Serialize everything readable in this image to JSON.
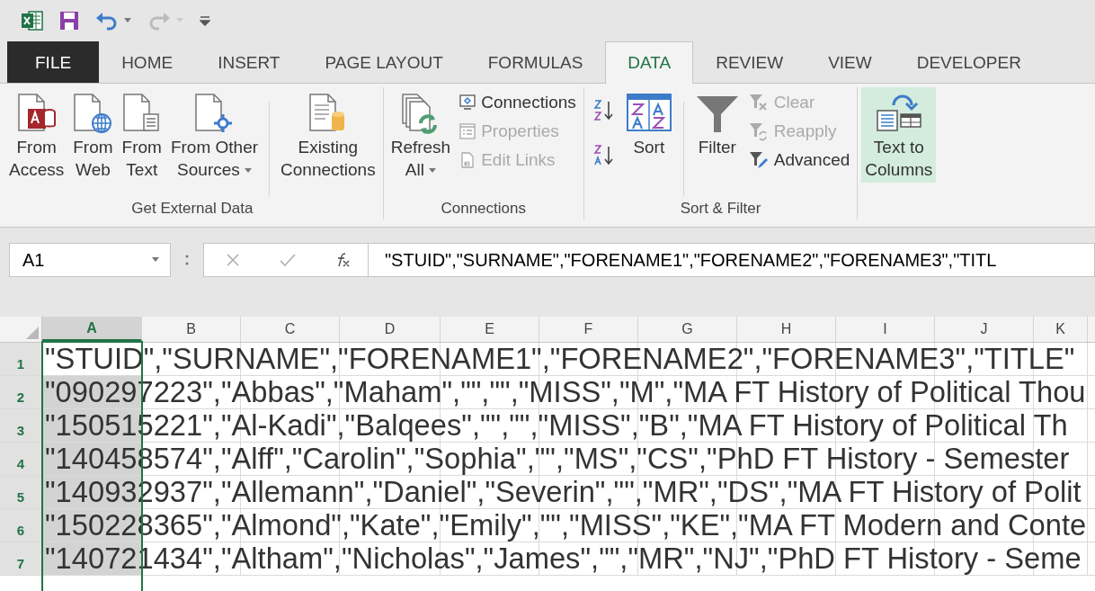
{
  "quick_access": [
    {
      "kind": "app",
      "disabled": false
    },
    {
      "kind": "save",
      "disabled": false
    },
    {
      "kind": "undo",
      "disabled": false
    },
    {
      "kind": "redo",
      "disabled": true
    },
    {
      "kind": "customize",
      "disabled": false
    }
  ],
  "tabs": [
    {
      "label": "FILE",
      "selected": false,
      "kind": "file"
    },
    {
      "label": "HOME",
      "selected": false,
      "kind": "tab"
    },
    {
      "label": "INSERT",
      "selected": false,
      "kind": "tab"
    },
    {
      "label": "PAGE LAYOUT",
      "selected": false,
      "kind": "tab"
    },
    {
      "label": "FORMULAS",
      "selected": false,
      "kind": "tab"
    },
    {
      "label": "DATA",
      "selected": true,
      "kind": "tab"
    },
    {
      "label": "REVIEW",
      "selected": false,
      "kind": "tab"
    },
    {
      "label": "VIEW",
      "selected": false,
      "kind": "tab"
    },
    {
      "label": "DEVELOPER",
      "selected": false,
      "kind": "tab"
    }
  ],
  "ribbon": {
    "groups": [
      {
        "label": "Get External Data",
        "items": [
          {
            "kind": "large",
            "label": "From\nAccess",
            "has_menu": false,
            "highlighted": false
          },
          {
            "kind": "large",
            "label": "From\nWeb",
            "has_menu": false,
            "highlighted": false
          },
          {
            "kind": "large",
            "label": "From\nText",
            "has_menu": false,
            "highlighted": false
          },
          {
            "kind": "large",
            "label": "From Other\nSources",
            "has_menu": true,
            "highlighted": false
          },
          {
            "kind": "separator"
          },
          {
            "kind": "large",
            "label": "Existing\nConnections",
            "has_menu": false,
            "highlighted": false
          }
        ]
      },
      {
        "label": "Connections",
        "items": [
          {
            "kind": "large",
            "label": "Refresh\nAll",
            "has_menu": true,
            "highlighted": false
          },
          {
            "kind": "stack",
            "buttons": [
              {
                "label": "Connections",
                "disabled": false
              },
              {
                "label": "Properties",
                "disabled": true
              },
              {
                "label": "Edit Links",
                "disabled": true
              }
            ]
          }
        ]
      },
      {
        "label": "Sort & Filter",
        "items": [
          {
            "kind": "iconstack"
          },
          {
            "kind": "large",
            "label": "Sort",
            "has_menu": false,
            "highlighted": false
          },
          {
            "kind": "separator"
          },
          {
            "kind": "large",
            "label": "Filter",
            "has_menu": false,
            "highlighted": false
          },
          {
            "kind": "stack",
            "buttons": [
              {
                "label": "Clear",
                "disabled": true
              },
              {
                "label": "Reapply",
                "disabled": true
              },
              {
                "label": "Advanced",
                "disabled": false
              }
            ]
          }
        ]
      },
      {
        "items": [
          {
            "kind": "large",
            "label": "Text to\nColumns",
            "has_menu": false,
            "highlighted": true
          }
        ]
      }
    ]
  },
  "formula_bar": {
    "name_box": "A1",
    "formula": "\"STUID\",\"SURNAME\",\"FORENAME1\",\"FORENAME2\",\"FORENAME3\",\"TITL"
  },
  "grid": {
    "columns": [
      {
        "label": "A",
        "selected": true
      },
      {
        "label": "B",
        "selected": false
      },
      {
        "label": "C",
        "selected": false
      },
      {
        "label": "D",
        "selected": false
      },
      {
        "label": "E",
        "selected": false
      },
      {
        "label": "F",
        "selected": false
      },
      {
        "label": "G",
        "selected": false
      },
      {
        "label": "H",
        "selected": false
      },
      {
        "label": "I",
        "selected": false
      },
      {
        "label": "J",
        "selected": false
      },
      {
        "label": "K",
        "selected": false
      }
    ],
    "rows": [
      {
        "number": "1",
        "active": true,
        "text": "\"STUID\",\"SURNAME\",\"FORENAME1\",\"FORENAME2\",\"FORENAME3\",\"TITLE\""
      },
      {
        "number": "2",
        "active": false,
        "text": "\"090297223\",\"Abbas\",\"Maham\",\"\",\"\",\"MISS\",\"M\",\"MA FT History of Political Thou"
      },
      {
        "number": "3",
        "active": false,
        "text": "\"150515221\",\"Al-Kadi\",\"Balqees\",\"\",\"\",\"MISS\",\"B\",\"MA FT History of Political Th"
      },
      {
        "number": "4",
        "active": false,
        "text": "\"140458574\",\"Alff\",\"Carolin\",\"Sophia\",\"\",\"MS\",\"CS\",\"PhD FT History - Semester"
      },
      {
        "number": "5",
        "active": false,
        "text": "\"140932937\",\"Allemann\",\"Daniel\",\"Severin\",\"\",\"MR\",\"DS\",\"MA FT History of Polit"
      },
      {
        "number": "6",
        "active": false,
        "text": "\"150228365\",\"Almond\",\"Kate\",\"Emily\",\"\",\"MISS\",\"KE\",\"MA FT Modern and Conte"
      },
      {
        "number": "7",
        "active": false,
        "text": "\"140721434\",\"Altham\",\"Nicholas\",\"James\",\"\",\"MR\",\"NJ\",\"PhD FT History - Seme"
      }
    ]
  }
}
